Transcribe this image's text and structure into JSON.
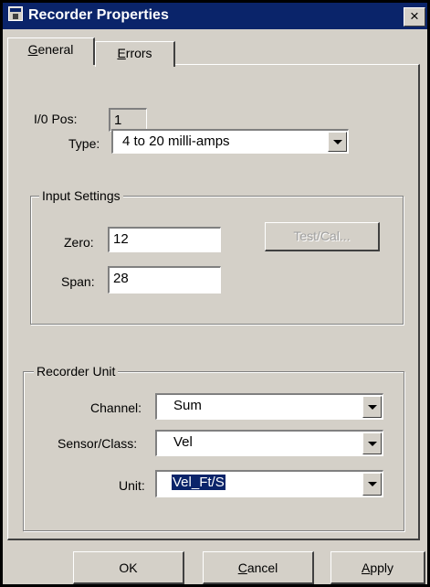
{
  "window": {
    "title": "Recorder Properties",
    "close_glyph": "×"
  },
  "tabs": [
    {
      "label": "General",
      "mnemonic": "G",
      "rest": "eneral",
      "active": true
    },
    {
      "label": "Errors",
      "mnemonic": "E",
      "rest": "rrors",
      "active": false
    }
  ],
  "general": {
    "io_pos": {
      "label": "I/0 Pos:",
      "value": "1"
    },
    "type": {
      "label": "Type:",
      "value": "4 to 20 milli-amps"
    }
  },
  "input_settings": {
    "title": "Input Settings",
    "zero": {
      "label": "Zero:",
      "value": "12"
    },
    "span": {
      "label": "Span:",
      "value": "28"
    },
    "test_cal_label": "Test/Cal..."
  },
  "recorder_unit": {
    "title": "Recorder Unit",
    "channel": {
      "label": "Channel:",
      "value": "Sum"
    },
    "sensor_class": {
      "label": "Sensor/Class:",
      "value": "Vel"
    },
    "unit": {
      "label": "Unit:",
      "value": "Vel_Ft/S"
    }
  },
  "buttons": {
    "ok": "OK",
    "cancel": {
      "mnemonic": "C",
      "rest": "ancel"
    },
    "apply": {
      "mnemonic": "A",
      "rest": "pply"
    }
  },
  "icons": {
    "system": "window-system-icon",
    "dropdown": "chevron-down-icon"
  },
  "colors": {
    "titlebar": "#0a246a",
    "face": "#d4d0c8",
    "selection": "#0a246a"
  }
}
